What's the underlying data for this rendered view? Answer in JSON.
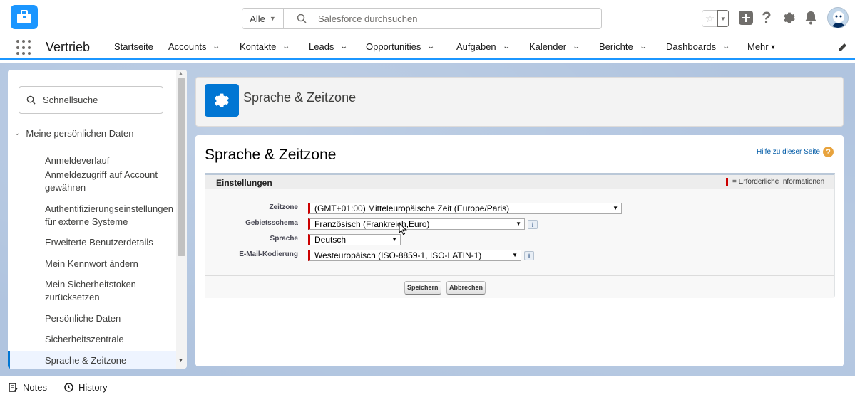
{
  "header": {
    "search_scope": "Alle",
    "search_placeholder": "Salesforce durchsuchen"
  },
  "nav": {
    "app_name": "Vertrieb",
    "items": [
      {
        "label": "Startseite"
      },
      {
        "label": "Accounts"
      },
      {
        "label": "Kontakte"
      },
      {
        "label": "Leads"
      },
      {
        "label": "Opportunities"
      },
      {
        "label": "Aufgaben"
      },
      {
        "label": "Kalender"
      },
      {
        "label": "Berichte"
      },
      {
        "label": "Dashboards"
      },
      {
        "label": "Mehr"
      }
    ]
  },
  "sidebar": {
    "quickfind_placeholder": "Schnellsuche",
    "section": "Meine persönlichen Daten",
    "items": [
      {
        "label": "Anmeldeverlauf"
      },
      {
        "label": "Anmeldezugriff auf Account gewähren"
      },
      {
        "label": "Authentifizierungseinstellungen für externe Systeme"
      },
      {
        "label": "Erweiterte Benutzerdetails"
      },
      {
        "label": "Mein Kennwort ändern"
      },
      {
        "label": "Mein Sicherheitstoken zurücksetzen"
      },
      {
        "label": "Persönliche Daten"
      },
      {
        "label": "Sicherheitszentrale"
      },
      {
        "label": "Sprache & Zeitzone"
      }
    ],
    "selected": "Sprache & Zeitzone"
  },
  "title_panel": {
    "title": "Sprache & Zeitzone"
  },
  "main": {
    "heading": "Sprache & Zeitzone",
    "help_link": "Hilfe zu dieser Seite",
    "block_title": "Einstellungen",
    "required_legend": "= Erforderliche Informationen",
    "fields": {
      "timezone": {
        "label": "Zeitzone",
        "value": "(GMT+01:00) Mitteleuropäische Zeit (Europe/Paris)"
      },
      "locale": {
        "label": "Gebietsschema",
        "value": "Französisch (Frankreich,Euro)"
      },
      "language": {
        "label": "Sprache",
        "value": "Deutsch"
      },
      "encoding": {
        "label": "E-Mail-Kodierung",
        "value": "Westeuropäisch (ISO-8859-1, ISO-LATIN-1)"
      }
    },
    "info_glyph": "i",
    "save_label": "Speichern",
    "cancel_label": "Abbrechen"
  },
  "utility_bar": {
    "notes_label": "Notes",
    "history_label": "History"
  },
  "colors": {
    "brand_blue": "#0176d3",
    "nav_accent": "#1b96ff",
    "required_red": "#cc0000",
    "workspace_bg": "#b0c4df"
  }
}
